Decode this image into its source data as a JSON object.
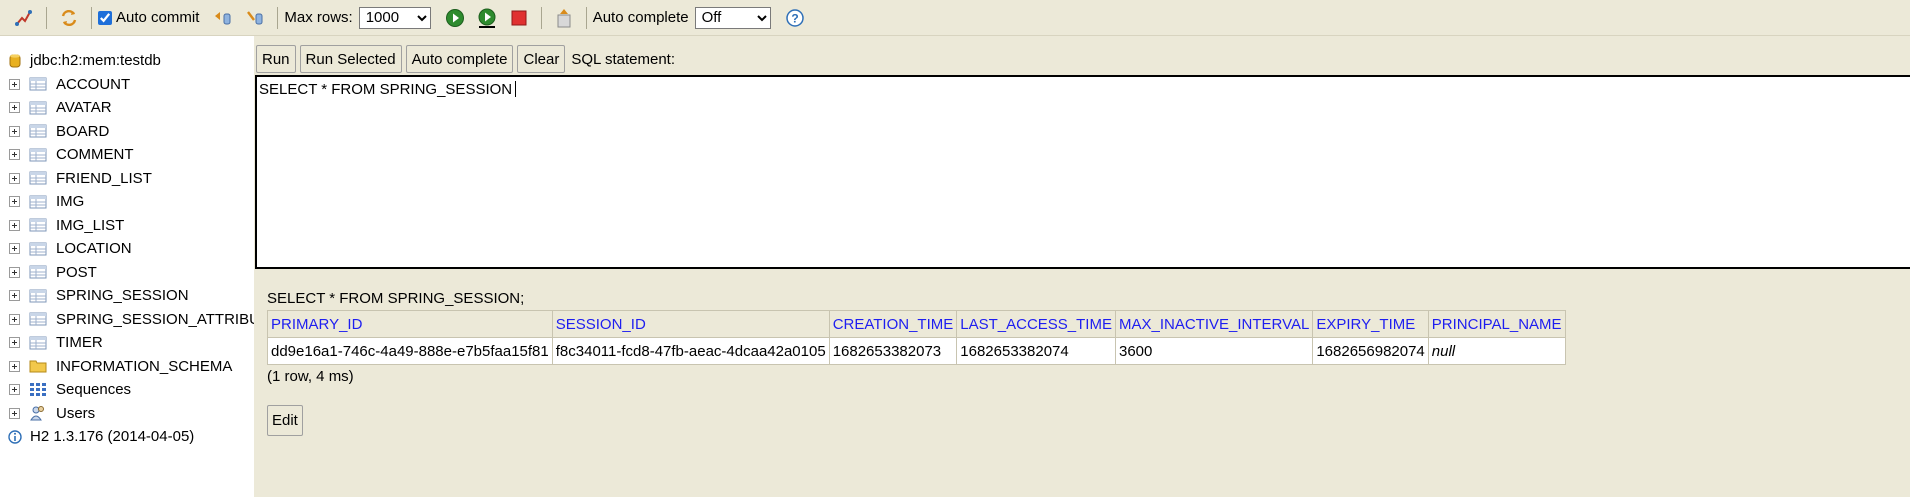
{
  "toolbar": {
    "icons": [
      "disconnect-icon",
      "refresh-icon",
      "rollback-icon",
      "commit-icon",
      "run-icon",
      "run-selected-icon",
      "cancel-icon",
      "history-icon",
      "help-icon"
    ],
    "auto_commit_label": "Auto commit",
    "auto_commit_checked": true,
    "max_rows_label": "Max rows:",
    "max_rows_value": "1000",
    "auto_complete_label": "Auto complete",
    "auto_complete_value": "Off"
  },
  "tree": {
    "connection": "jdbc:h2:mem:testdb",
    "tables": [
      "ACCOUNT",
      "AVATAR",
      "BOARD",
      "COMMENT",
      "FRIEND_LIST",
      "IMG",
      "IMG_LIST",
      "LOCATION",
      "POST",
      "SPRING_SESSION",
      "SPRING_SESSION_ATTRIBUTES",
      "TIMER"
    ],
    "schema": "INFORMATION_SCHEMA",
    "sequences": "Sequences",
    "users": "Users",
    "version": "H2 1.3.176 (2014-04-05)"
  },
  "editor": {
    "run_label": "Run",
    "run_selected_label": "Run Selected",
    "auto_complete_label": "Auto complete",
    "clear_label": "Clear",
    "sql_statement_label": "SQL statement:",
    "sql_text": "SELECT * FROM SPRING_SESSION"
  },
  "results": {
    "query": "SELECT * FROM SPRING_SESSION;",
    "columns": [
      "PRIMARY_ID",
      "SESSION_ID",
      "CREATION_TIME",
      "LAST_ACCESS_TIME",
      "MAX_INACTIVE_INTERVAL",
      "EXPIRY_TIME",
      "PRINCIPAL_NAME"
    ],
    "rows": [
      [
        "dd9e16a1-746c-4a49-888e-e7b5faa15f81",
        "f8c34011-fcd8-47fb-aeac-4dcaa42a0105",
        "1682653382073",
        "1682653382074",
        "3600",
        "1682656982074",
        "null"
      ]
    ],
    "row_count": "(1 row, 4 ms)",
    "edit_label": "Edit"
  }
}
